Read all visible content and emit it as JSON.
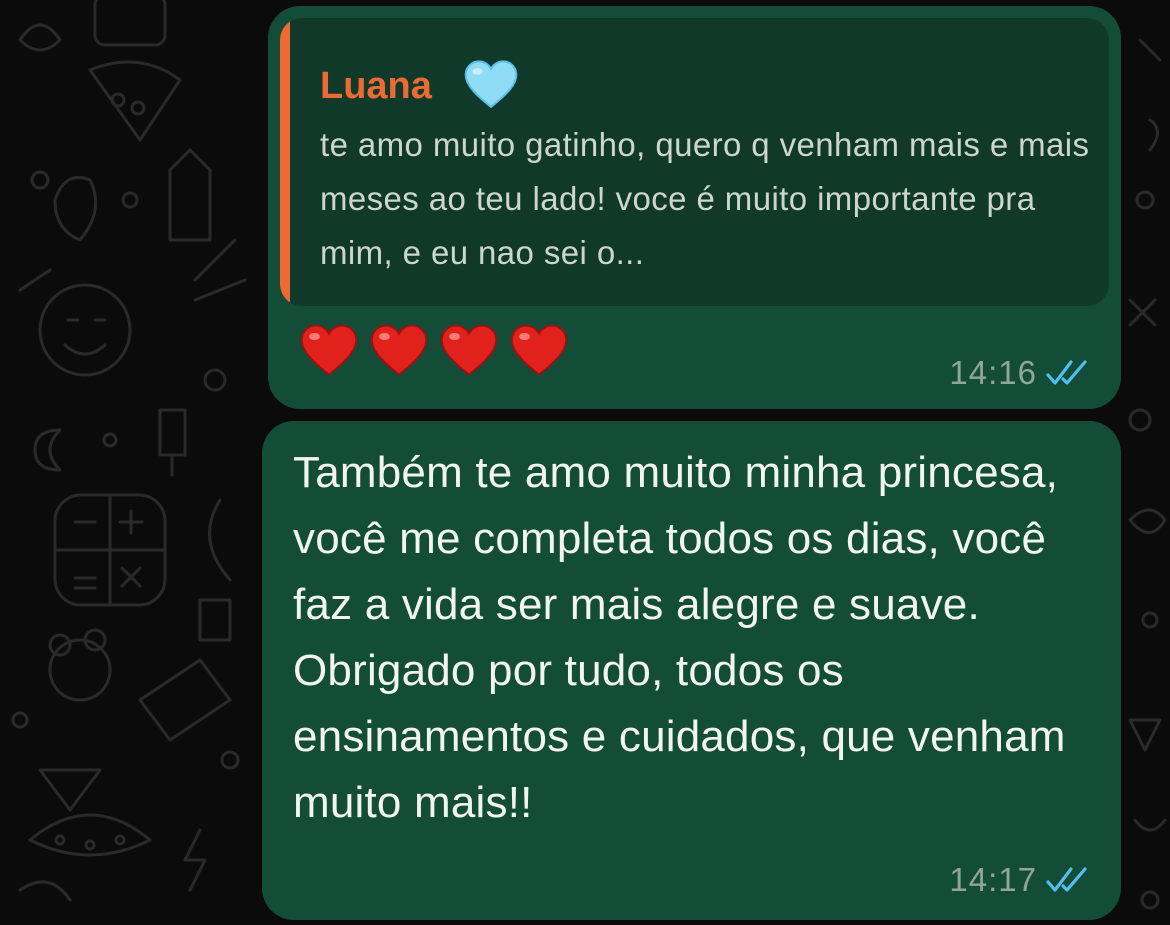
{
  "chat": {
    "messages": [
      {
        "direction": "outgoing",
        "quoted": {
          "author": "Luana",
          "author_emoji": "light-blue-heart",
          "text": "te amo muito gatinho, quero q venham mais e mais meses ao teu lado! voce é muito importante pra mim, e eu nao sei o..."
        },
        "text_emoji": [
          "red-heart",
          "red-heart",
          "red-heart",
          "red-heart"
        ],
        "time": "14:16",
        "status": "read"
      },
      {
        "direction": "outgoing",
        "text": "Também te amo muito minha princesa, você me completa todos os dias, você faz a vida ser mais alegre e suave. Obrigado por tudo, todos os ensinamentos e cuidados, que venham muito mais!!",
        "time": "14:17",
        "status": "read"
      }
    ]
  },
  "colors": {
    "bubble": "#134d37",
    "quote_background": "#10392a",
    "quote_accent": "#ee6a34",
    "read_ticks": "#53bdeb",
    "wallpaper": "#0b0b0b"
  }
}
